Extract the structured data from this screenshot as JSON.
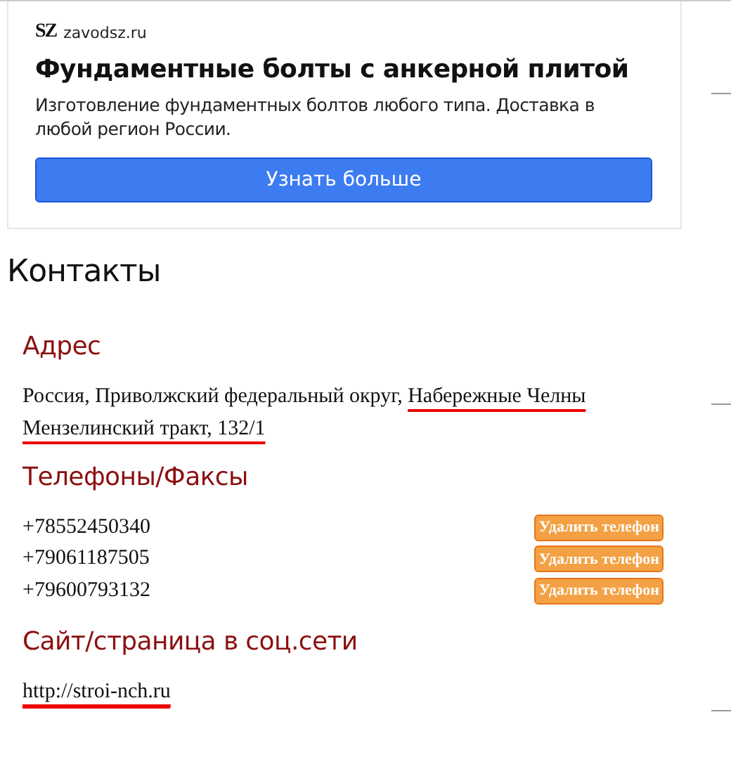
{
  "ad": {
    "logo": "SZ",
    "domain": "zavodsz.ru",
    "title": "Фундаментные болты с анкерной плитой",
    "description": "Изготовление фундаментных болтов любого типа. Доставка в любой регион России.",
    "button": "Узнать больше"
  },
  "contacts": {
    "title": "Контакты",
    "address": {
      "heading": "Адрес",
      "text": "Россия, Приволжский федеральный округ, ",
      "underlined_text": "Набережные Челны Мензелинский тракт, 132/1"
    },
    "phones": {
      "heading": "Телефоны/Факсы",
      "items": [
        {
          "number": "+78552450340",
          "button": "Удалить телефон"
        },
        {
          "number": "+79061187505",
          "button": "Удалить телефон"
        },
        {
          "number": "+79600793132",
          "button": "Удалить телефон"
        }
      ]
    },
    "site": {
      "heading": "Сайт/страница в соц.сети",
      "link": "http://stroi-nch.ru",
      "underlined": true
    }
  }
}
